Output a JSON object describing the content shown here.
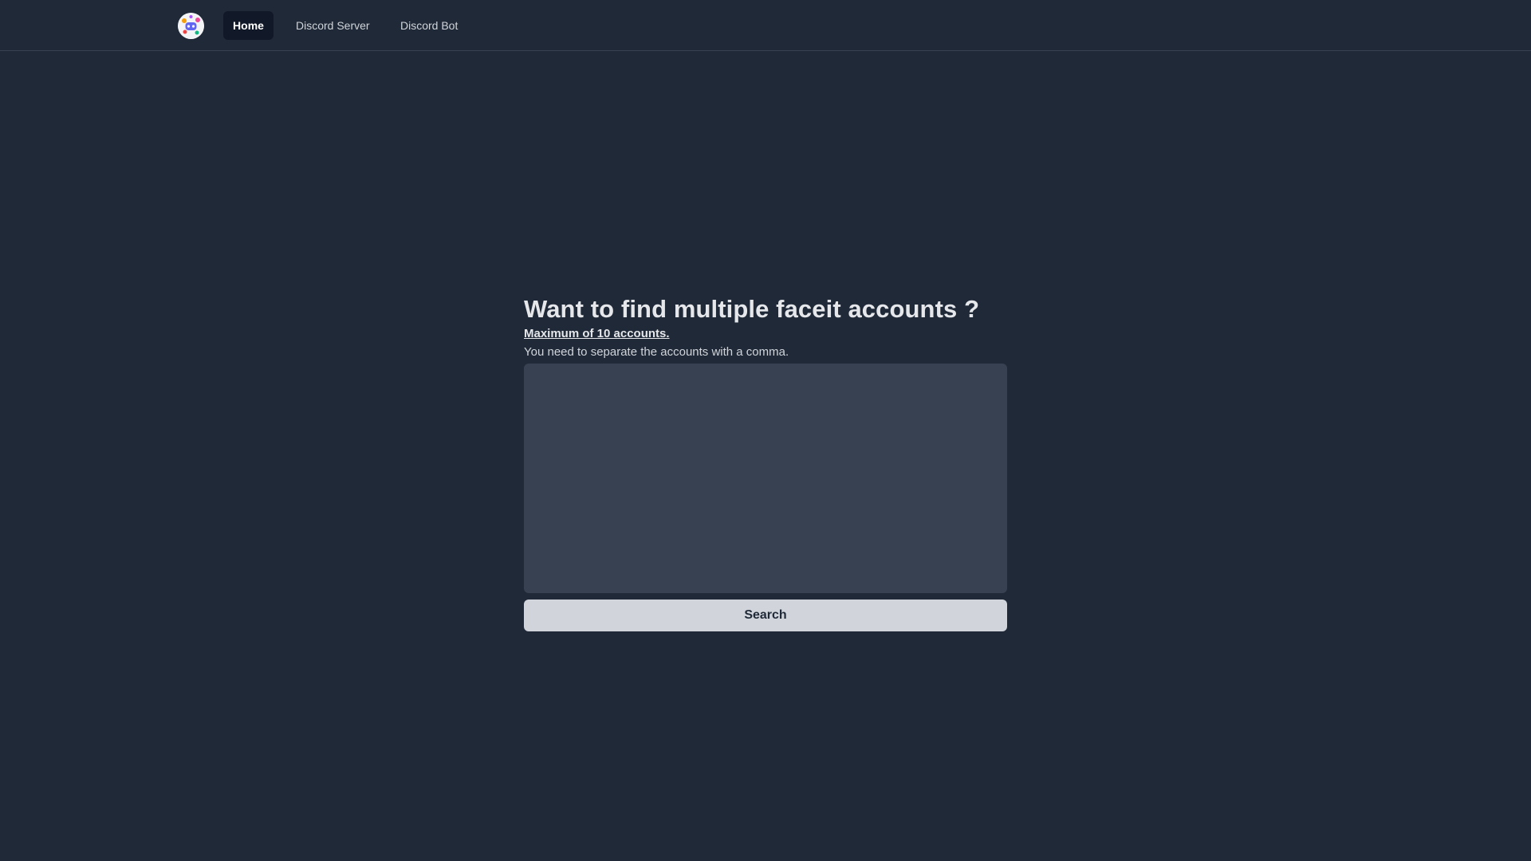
{
  "nav": {
    "logo_icon": "discord-bot-avatar-icon",
    "items": [
      {
        "label": "Home",
        "active": true
      },
      {
        "label": "Discord Server",
        "active": false
      },
      {
        "label": "Discord Bot",
        "active": false
      }
    ]
  },
  "main": {
    "headline": "Want to find multiple faceit accounts ?",
    "max_note": "Maximum of 10 accounts.",
    "help_text": "You need to separate the accounts with a comma.",
    "textarea_value": "",
    "search_label": "Search"
  },
  "colors": {
    "background": "#1f2937",
    "nav_active_bg": "#111827",
    "textarea_bg": "#374151",
    "button_bg": "#d1d5db"
  }
}
